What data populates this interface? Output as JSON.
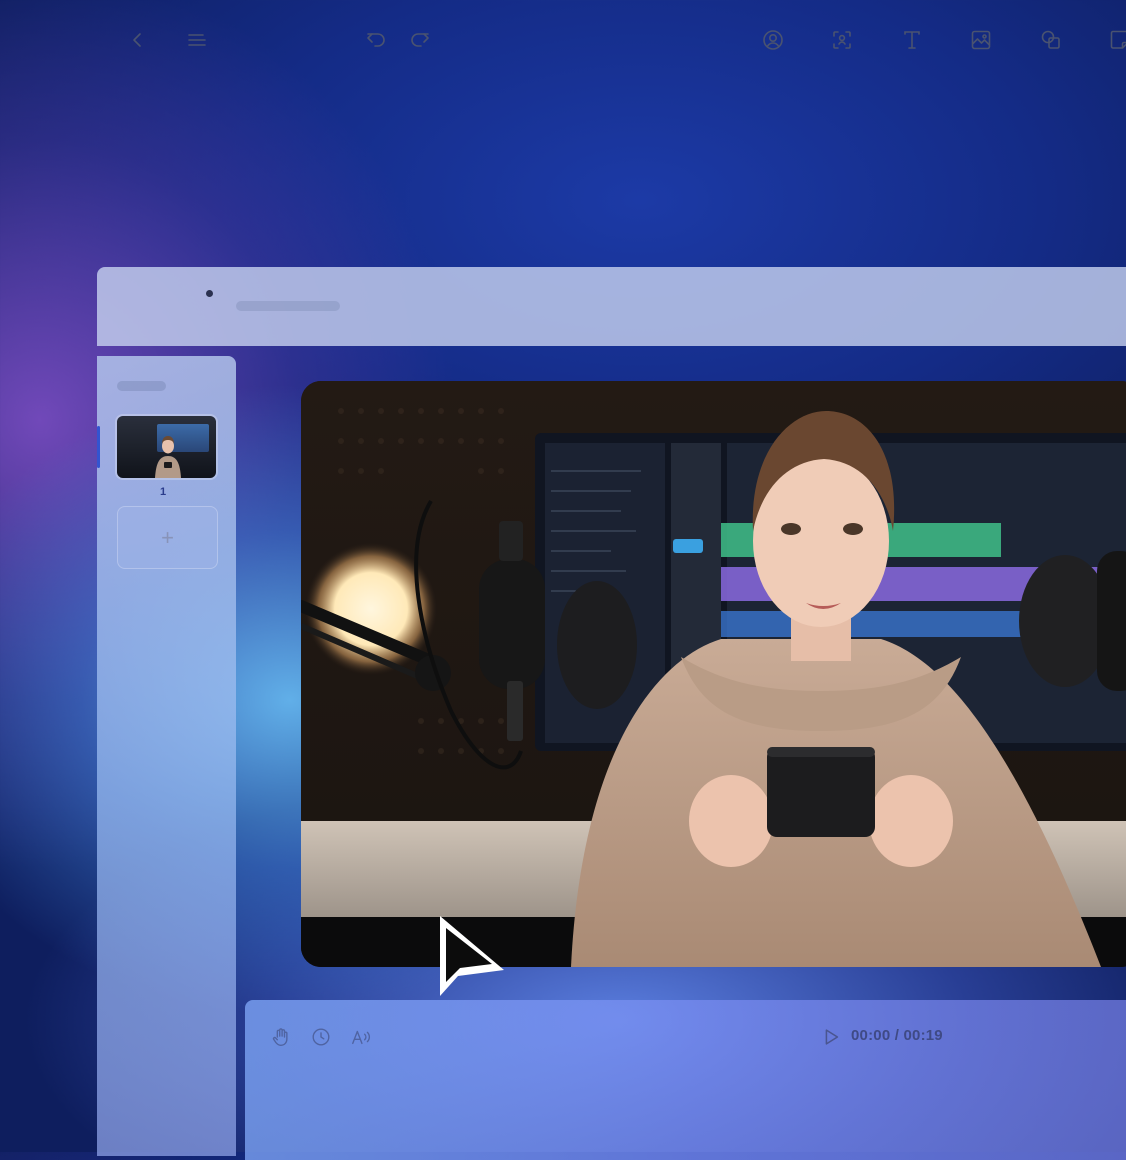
{
  "toolbar": {
    "icons": [
      "back-icon",
      "menu-icon",
      "undo-icon",
      "redo-icon",
      "avatar-icon",
      "face-frame-icon",
      "text-icon",
      "media-icon",
      "shapes-icon",
      "sticker-icon"
    ]
  },
  "sidebar": {
    "slides": [
      {
        "number": "1"
      }
    ],
    "add_label": "+"
  },
  "timeline": {
    "time_current": "00:00",
    "time_separator": " / ",
    "time_total": "00:19",
    "icons": [
      "gesture-icon",
      "clock-icon",
      "voice-icon",
      "play-icon"
    ]
  },
  "colors": {
    "accent": "#3354d0",
    "toolbar_bg": "#c4d0ee",
    "icon": "#4a5370"
  }
}
